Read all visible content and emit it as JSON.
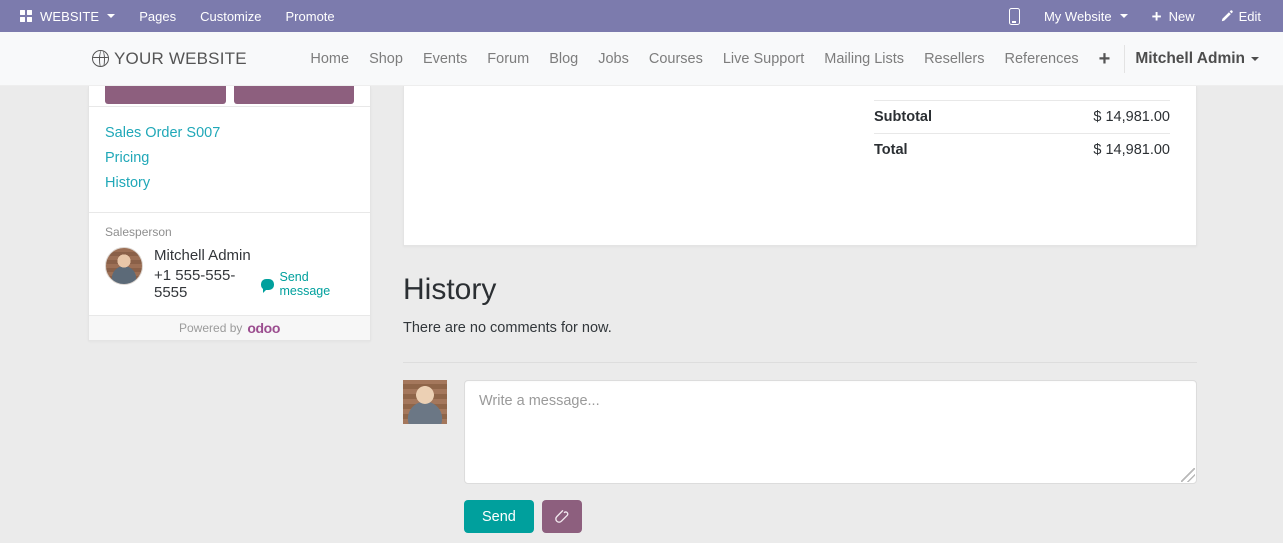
{
  "colors": {
    "odoo_purple": "#7c7bad",
    "teal": "#00a09d",
    "link_teal": "#20a8b8",
    "button_purple": "#8d5f7e",
    "page_bg": "#ebebeb"
  },
  "topbar": {
    "brand": "WEBSITE",
    "brand_icon": "apps-grid-icon",
    "brand_caret_icon": "caret-down-icon",
    "items": [
      {
        "label": "Pages",
        "name": "pages"
      },
      {
        "label": "Customize",
        "name": "customize"
      },
      {
        "label": "Promote",
        "name": "promote"
      }
    ],
    "mobile_icon": "mobile-preview-icon",
    "site_selector": "My Website",
    "site_caret_icon": "caret-down-icon",
    "new_label": "New",
    "new_icon": "plus-icon",
    "edit_label": "Edit",
    "edit_icon": "pencil-icon"
  },
  "sitenav": {
    "logo_text": "YOUR WEBSITE",
    "logo_icon": "globe-icon",
    "links": [
      {
        "label": "Home"
      },
      {
        "label": "Shop"
      },
      {
        "label": "Events"
      },
      {
        "label": "Forum"
      },
      {
        "label": "Blog"
      },
      {
        "label": "Jobs"
      },
      {
        "label": "Courses"
      },
      {
        "label": "Live Support"
      },
      {
        "label": "Mailing Lists"
      },
      {
        "label": "Resellers"
      },
      {
        "label": "References"
      }
    ],
    "plus_label": "+",
    "user": "Mitchell Admin",
    "user_caret_icon": "caret-down-icon"
  },
  "sidebar": {
    "links": [
      {
        "label": "Sales Order S007"
      },
      {
        "label": "Pricing"
      },
      {
        "label": "History"
      }
    ],
    "salesperson": {
      "section_label": "Salesperson",
      "name": "Mitchell Admin",
      "phone": "+1 555-555-5555",
      "message_link": "Send message",
      "message_icon": "chat-bubble-icon",
      "avatar_icon": "user-avatar"
    },
    "footer": {
      "powered_by": "Powered by",
      "brand": "odoo"
    }
  },
  "order": {
    "totals": [
      {
        "label": "Subtotal",
        "value": "$ 14,981.00"
      },
      {
        "label": "Total",
        "value": "$ 14,981.00"
      }
    ]
  },
  "history": {
    "title": "History",
    "empty_text": "There are no comments for now.",
    "composer": {
      "avatar_icon": "user-avatar",
      "placeholder": "Write a message...",
      "value": "",
      "send_label": "Send",
      "attach_icon": "paperclip-icon",
      "resize_icon": "resize-grip-icon"
    }
  }
}
